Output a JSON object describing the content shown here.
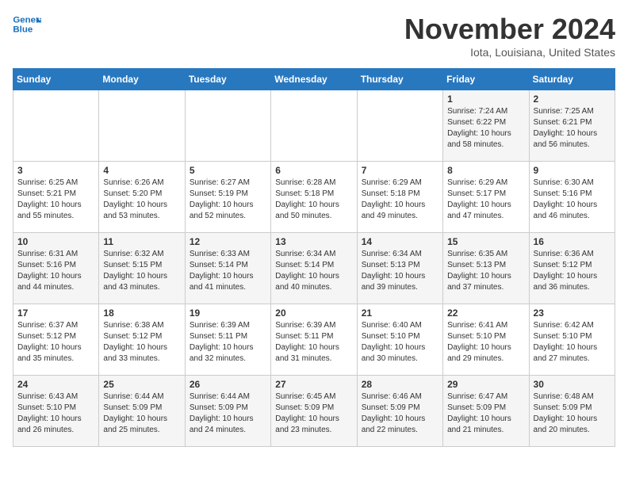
{
  "header": {
    "logo_line1": "General",
    "logo_line2": "Blue",
    "month": "November 2024",
    "location": "Iota, Louisiana, United States"
  },
  "days_of_week": [
    "Sunday",
    "Monday",
    "Tuesday",
    "Wednesday",
    "Thursday",
    "Friday",
    "Saturday"
  ],
  "weeks": [
    [
      {
        "num": "",
        "info": ""
      },
      {
        "num": "",
        "info": ""
      },
      {
        "num": "",
        "info": ""
      },
      {
        "num": "",
        "info": ""
      },
      {
        "num": "",
        "info": ""
      },
      {
        "num": "1",
        "info": "Sunrise: 7:24 AM\nSunset: 6:22 PM\nDaylight: 10 hours\nand 58 minutes."
      },
      {
        "num": "2",
        "info": "Sunrise: 7:25 AM\nSunset: 6:21 PM\nDaylight: 10 hours\nand 56 minutes."
      }
    ],
    [
      {
        "num": "3",
        "info": "Sunrise: 6:25 AM\nSunset: 5:21 PM\nDaylight: 10 hours\nand 55 minutes."
      },
      {
        "num": "4",
        "info": "Sunrise: 6:26 AM\nSunset: 5:20 PM\nDaylight: 10 hours\nand 53 minutes."
      },
      {
        "num": "5",
        "info": "Sunrise: 6:27 AM\nSunset: 5:19 PM\nDaylight: 10 hours\nand 52 minutes."
      },
      {
        "num": "6",
        "info": "Sunrise: 6:28 AM\nSunset: 5:18 PM\nDaylight: 10 hours\nand 50 minutes."
      },
      {
        "num": "7",
        "info": "Sunrise: 6:29 AM\nSunset: 5:18 PM\nDaylight: 10 hours\nand 49 minutes."
      },
      {
        "num": "8",
        "info": "Sunrise: 6:29 AM\nSunset: 5:17 PM\nDaylight: 10 hours\nand 47 minutes."
      },
      {
        "num": "9",
        "info": "Sunrise: 6:30 AM\nSunset: 5:16 PM\nDaylight: 10 hours\nand 46 minutes."
      }
    ],
    [
      {
        "num": "10",
        "info": "Sunrise: 6:31 AM\nSunset: 5:16 PM\nDaylight: 10 hours\nand 44 minutes."
      },
      {
        "num": "11",
        "info": "Sunrise: 6:32 AM\nSunset: 5:15 PM\nDaylight: 10 hours\nand 43 minutes."
      },
      {
        "num": "12",
        "info": "Sunrise: 6:33 AM\nSunset: 5:14 PM\nDaylight: 10 hours\nand 41 minutes."
      },
      {
        "num": "13",
        "info": "Sunrise: 6:34 AM\nSunset: 5:14 PM\nDaylight: 10 hours\nand 40 minutes."
      },
      {
        "num": "14",
        "info": "Sunrise: 6:34 AM\nSunset: 5:13 PM\nDaylight: 10 hours\nand 39 minutes."
      },
      {
        "num": "15",
        "info": "Sunrise: 6:35 AM\nSunset: 5:13 PM\nDaylight: 10 hours\nand 37 minutes."
      },
      {
        "num": "16",
        "info": "Sunrise: 6:36 AM\nSunset: 5:12 PM\nDaylight: 10 hours\nand 36 minutes."
      }
    ],
    [
      {
        "num": "17",
        "info": "Sunrise: 6:37 AM\nSunset: 5:12 PM\nDaylight: 10 hours\nand 35 minutes."
      },
      {
        "num": "18",
        "info": "Sunrise: 6:38 AM\nSunset: 5:12 PM\nDaylight: 10 hours\nand 33 minutes."
      },
      {
        "num": "19",
        "info": "Sunrise: 6:39 AM\nSunset: 5:11 PM\nDaylight: 10 hours\nand 32 minutes."
      },
      {
        "num": "20",
        "info": "Sunrise: 6:39 AM\nSunset: 5:11 PM\nDaylight: 10 hours\nand 31 minutes."
      },
      {
        "num": "21",
        "info": "Sunrise: 6:40 AM\nSunset: 5:10 PM\nDaylight: 10 hours\nand 30 minutes."
      },
      {
        "num": "22",
        "info": "Sunrise: 6:41 AM\nSunset: 5:10 PM\nDaylight: 10 hours\nand 29 minutes."
      },
      {
        "num": "23",
        "info": "Sunrise: 6:42 AM\nSunset: 5:10 PM\nDaylight: 10 hours\nand 27 minutes."
      }
    ],
    [
      {
        "num": "24",
        "info": "Sunrise: 6:43 AM\nSunset: 5:10 PM\nDaylight: 10 hours\nand 26 minutes."
      },
      {
        "num": "25",
        "info": "Sunrise: 6:44 AM\nSunset: 5:09 PM\nDaylight: 10 hours\nand 25 minutes."
      },
      {
        "num": "26",
        "info": "Sunrise: 6:44 AM\nSunset: 5:09 PM\nDaylight: 10 hours\nand 24 minutes."
      },
      {
        "num": "27",
        "info": "Sunrise: 6:45 AM\nSunset: 5:09 PM\nDaylight: 10 hours\nand 23 minutes."
      },
      {
        "num": "28",
        "info": "Sunrise: 6:46 AM\nSunset: 5:09 PM\nDaylight: 10 hours\nand 22 minutes."
      },
      {
        "num": "29",
        "info": "Sunrise: 6:47 AM\nSunset: 5:09 PM\nDaylight: 10 hours\nand 21 minutes."
      },
      {
        "num": "30",
        "info": "Sunrise: 6:48 AM\nSunset: 5:09 PM\nDaylight: 10 hours\nand 20 minutes."
      }
    ]
  ]
}
